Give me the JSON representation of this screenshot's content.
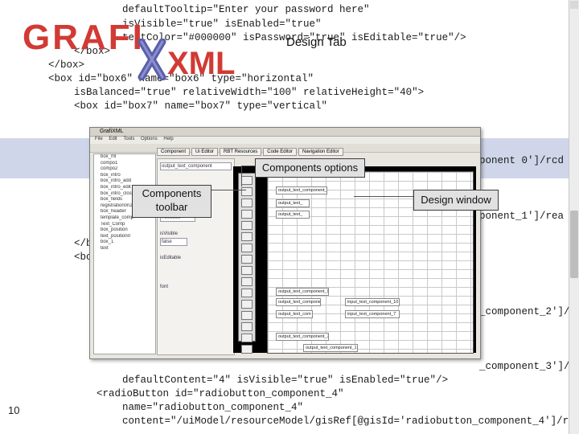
{
  "code_lines": [
    "defaultTooltip=\"Enter your password here\"",
    "isVisible=\"true\" isEnabled=\"true\"",
    "textColor=\"#000000\" isPassword=\"true\" isEditable=\"true\"/>",
    "</box>",
    "</box>",
    "<box id=\"box6\" name=\"box6\" type=\"horizontal\"",
    "isBalanced=\"true\" relativeWidth=\"100\" relativeHeight=\"40\">",
    "<box id=\"box7\" name=\"box7\" type=\"vertical\"",
    "ponent 0']/rcd",
    "ponent_1']/rea",
    "</b",
    "<bo",
    "_component_2']/",
    "_component_3']/",
    "defaultContent=\"4\" isVisible=\"true\" isEnabled=\"true\"/>",
    "<radioButton id=\"radiobutton_component_4\"",
    "name=\"radiobutton_component_4\"",
    "content=\"/uiModel/resourceModel/gisRef[@gisId='radiobutton_component_4']/r"
  ],
  "logo": {
    "grafi": "GRAFI",
    "xml": "XML"
  },
  "design_tab_label": "Design Tab",
  "page_number": "10",
  "callouts": {
    "components_options": "Components options",
    "components_toolbar": "Components\ntoolbar",
    "design_window": "Design window"
  },
  "app": {
    "title": "GrafiXML",
    "menu": [
      "File",
      "Edit",
      "Tools",
      "Options",
      "Help"
    ],
    "tabs": [
      "Component",
      "Ui Editor",
      "RBT Resources",
      "Code Editor",
      "Navigation Editor"
    ],
    "tree_items": [
      "box_ml",
      "compo1",
      "compo2",
      "box_intro",
      "box_intro_add",
      "box_intro_edit",
      "box_intro_close",
      "box_fields",
      "registration0n2",
      "box_header",
      "template_comp",
      "Text_Comp",
      "box_position",
      "text_position0",
      "box_1",
      "text"
    ],
    "props": [
      "output_text_component",
      "fgColor",
      "#000000",
      "bgColor",
      "#000000",
      "isVisible",
      "false",
      "isEditable",
      "font"
    ],
    "design_cells": [
      "output_text_component_0",
      "output_text_",
      "output_text_",
      "output_text_component_9",
      "output_text_componen",
      "input_text_component_10",
      "output_text_com",
      "input_text_component_7",
      "output_text_component_1",
      "output_text_component_7"
    ]
  }
}
